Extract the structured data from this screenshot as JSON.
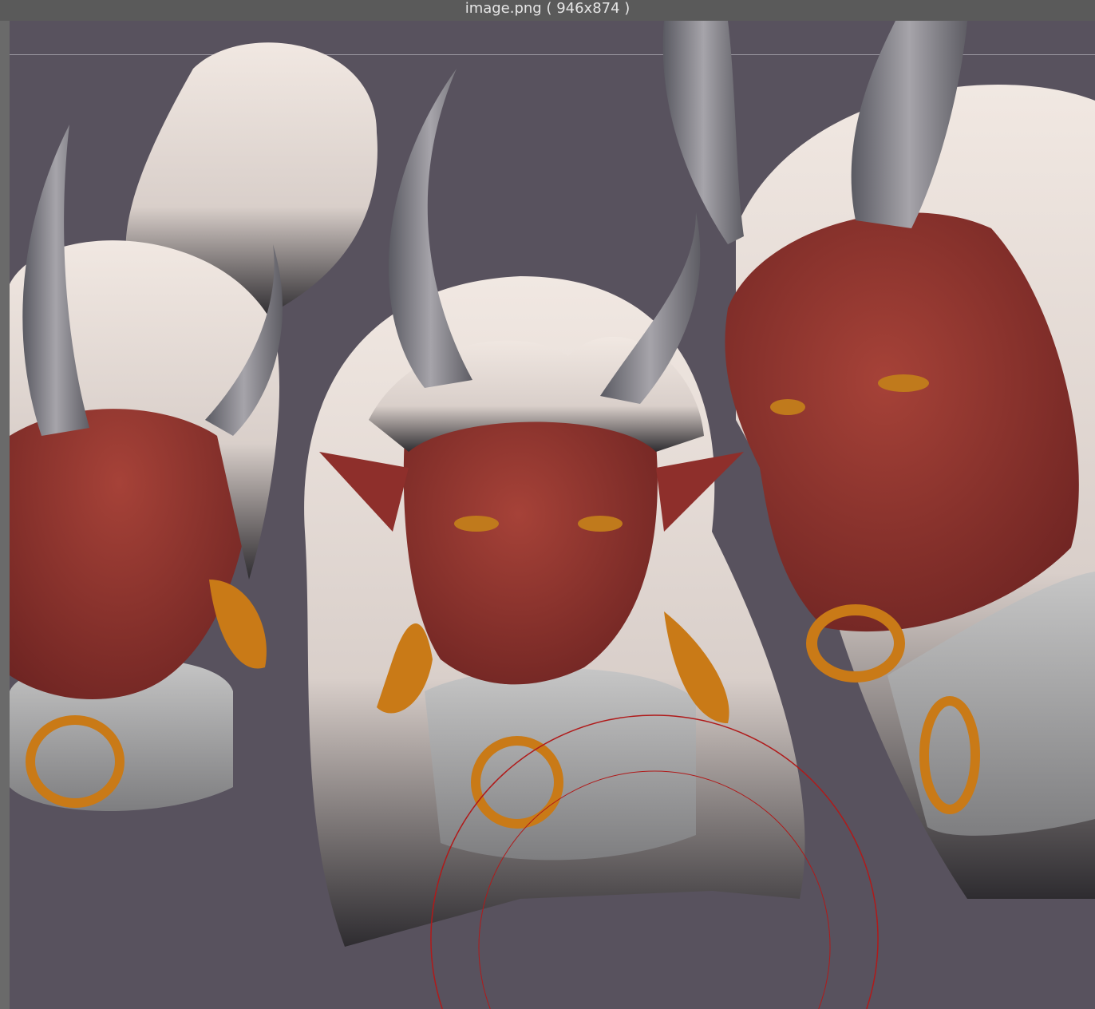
{
  "window": {
    "title": "image.png ( 946x874 )"
  },
  "colors": {
    "background": "#58525e",
    "skin": "#8e2f2b",
    "hair": "#e8ddd6",
    "horn": "#7c7a80",
    "metal": "#a9a9a9",
    "gold": "#c97a17",
    "brush": "#b01a1a"
  }
}
